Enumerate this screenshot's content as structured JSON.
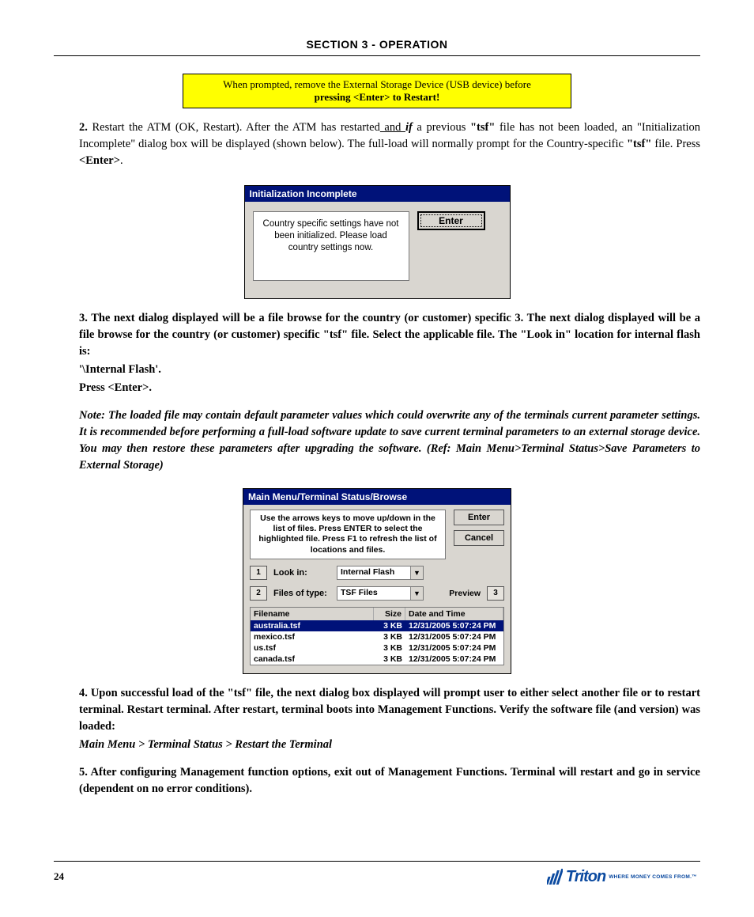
{
  "header": {
    "title": "SECTION 3 - OPERATION"
  },
  "yellow_box": {
    "line1": "When prompted, remove the External Storage Device (USB device) before",
    "line2": "pressing <Enter> to Restart!"
  },
  "para1": {
    "prefix": "2.",
    "text_a": "  Restart the ATM (OK, Restart). After the ATM has restarted",
    "text_b": " and ",
    "text_c": "if ",
    "text_d": "a previous ",
    "text_e": "\"tsf\"",
    "text_f": " file has not been loaded, an \"Initialization Incomplete\" dialog box will be displayed (shown below). The full-load will normally prompt for the Country-specific ",
    "text_g": "\"tsf\"",
    "text_h": " file. Press ",
    "enter1": "<Enter>",
    "period": "."
  },
  "dialog1": {
    "title": "Initialization Incomplete",
    "message": "Country specific settings have not been initialized.  Please load country settings now.",
    "enter": "Enter"
  },
  "para2_a": "3.  The next dialog displayed will be a file browse for the country (or customer) specific ",
  "para2_b": "\"tsf\"",
  "para2_c": " file. Select the applicable file. The ",
  "para2_d": "\"Look in\"",
  "para2_e": " location for internal flash is:",
  "para2_path": "     '\\Internal Flash'.",
  "para2_f": "Press ",
  "para2_enter": "<Enter>",
  "para2_g": ".",
  "note_label": "Note:",
  "note_text": " The loaded file may contain default parameter values which could overwrite any of the terminals current parameter settings. It is recommended before performing a full-load software update to save current terminal parameters to an external storage device. You may then restore these parameters after upgrading the software. (Ref: Main Menu>Terminal Status>Save Parameters to External Storage)",
  "dialog2": {
    "title": "Main Menu/Terminal Status/Browse",
    "instruct": "Use the arrows keys to move up/down in the list of files.  Press ENTER to select the highlighted file.  Press F1 to refresh the list of locations and files.",
    "enter": "Enter",
    "cancel": "Cancel",
    "row1_btn": "1",
    "row1_lbl": "Look in:",
    "row1_combo": "Internal Flash",
    "row2_btn": "2",
    "row2_lbl": "Files of type:",
    "row2_combo": "TSF Files",
    "preview_lbl": "Preview",
    "preview_btn": "3",
    "cols": {
      "filename": "Filename",
      "size": "Size",
      "date": "Date and Time"
    },
    "rows": [
      {
        "fn": "australia.tsf",
        "sz": "3 KB",
        "dt": "12/31/2005 5:07:24 PM",
        "sel": true
      },
      {
        "fn": "mexico.tsf",
        "sz": "3 KB",
        "dt": "12/31/2005 5:07:24 PM",
        "sel": false
      },
      {
        "fn": "us.tsf",
        "sz": "3 KB",
        "dt": "12/31/2005 5:07:24 PM",
        "sel": false
      },
      {
        "fn": "canada.tsf",
        "sz": "3 KB",
        "dt": "12/31/2005 5:07:24 PM",
        "sel": false
      }
    ]
  },
  "para3_a": "4.  Upon successful load of the ",
  "para3_b": "\"tsf\"",
  "para3_c": " file, the next dialog box displayed will prompt user to either select another file or to restart terminal. Restart terminal. After restart, terminal boots into Management Functions. Verify the software file (and version) was loaded:",
  "para3_path": "Main Menu > Terminal Status > Restart the Terminal",
  "para4": "5.  After configuring Management function options, exit out of Management Functions. Terminal will restart and go in service (dependent on no error conditions).",
  "footer": {
    "page": "24",
    "brand": "Triton",
    "tagline": "WHERE MONEY COMES FROM.™"
  }
}
